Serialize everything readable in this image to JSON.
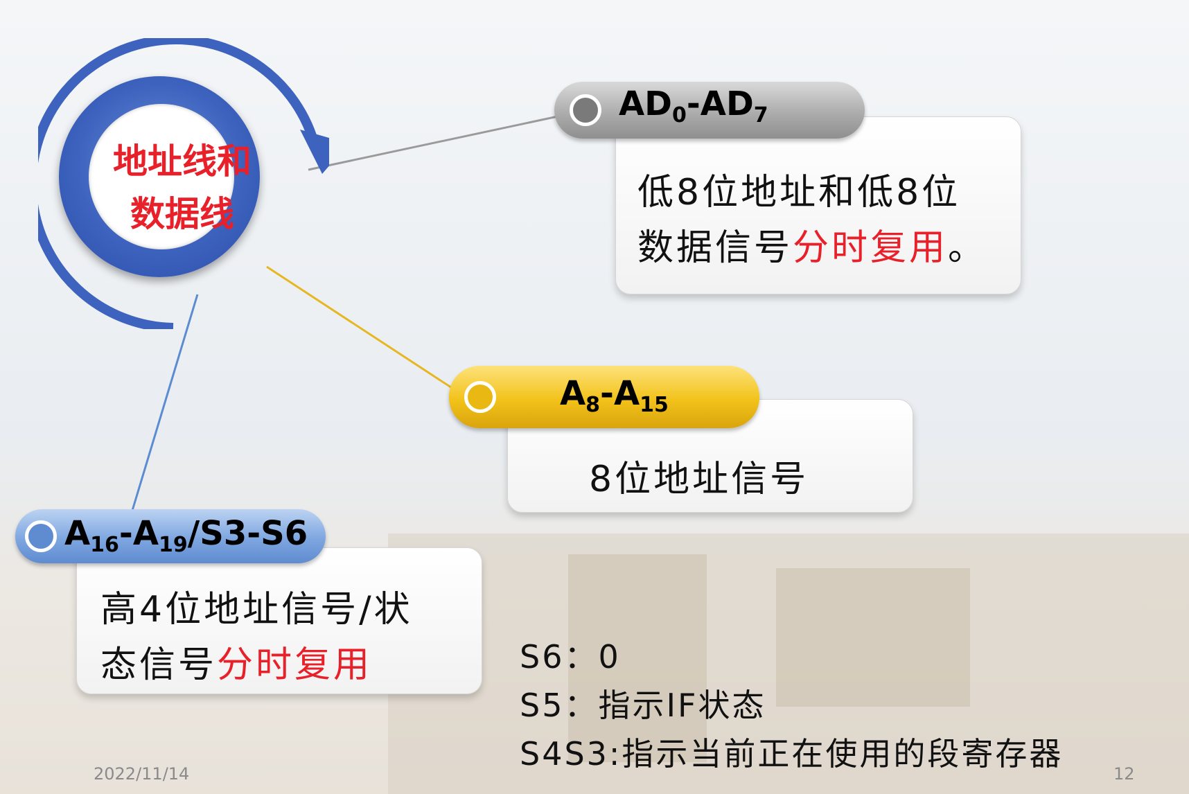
{
  "hub": {
    "line1": "地址线和",
    "line2": "数据线"
  },
  "nodes": [
    {
      "base": "AD",
      "sub0": "0",
      "sep": "-AD",
      "sub1": "7",
      "tail": "",
      "desc_line1": "低8位地址和低8位",
      "desc_line2_a": "数据信号",
      "desc_line2_b": "分时复用",
      "desc_line2_c": "。"
    },
    {
      "base": "A",
      "sub0": "8",
      "sep": "-A",
      "sub1": "15",
      "tail": "",
      "desc_line1": "8位地址信号"
    },
    {
      "base": "A",
      "sub0": "16",
      "sep": "-A",
      "sub1": "19",
      "tail": "/S3-S6",
      "desc_line1": "高4位地址信号/状",
      "desc_line2_a": "态信号",
      "desc_line2_b": "分时复用"
    }
  ],
  "notes": [
    "S6：0",
    "S5：指示IF状态",
    "S4S3:指示当前正在使用的段寄存器"
  ],
  "footer": {
    "date": "2022/11/14",
    "page": "12"
  },
  "colors": {
    "accent_red": "#e8202a",
    "hub_blue": "#3d63bf",
    "gray_pill": "#a9a9a9",
    "gold_pill": "#f2c21a",
    "blue_pill": "#7ea6e0"
  }
}
